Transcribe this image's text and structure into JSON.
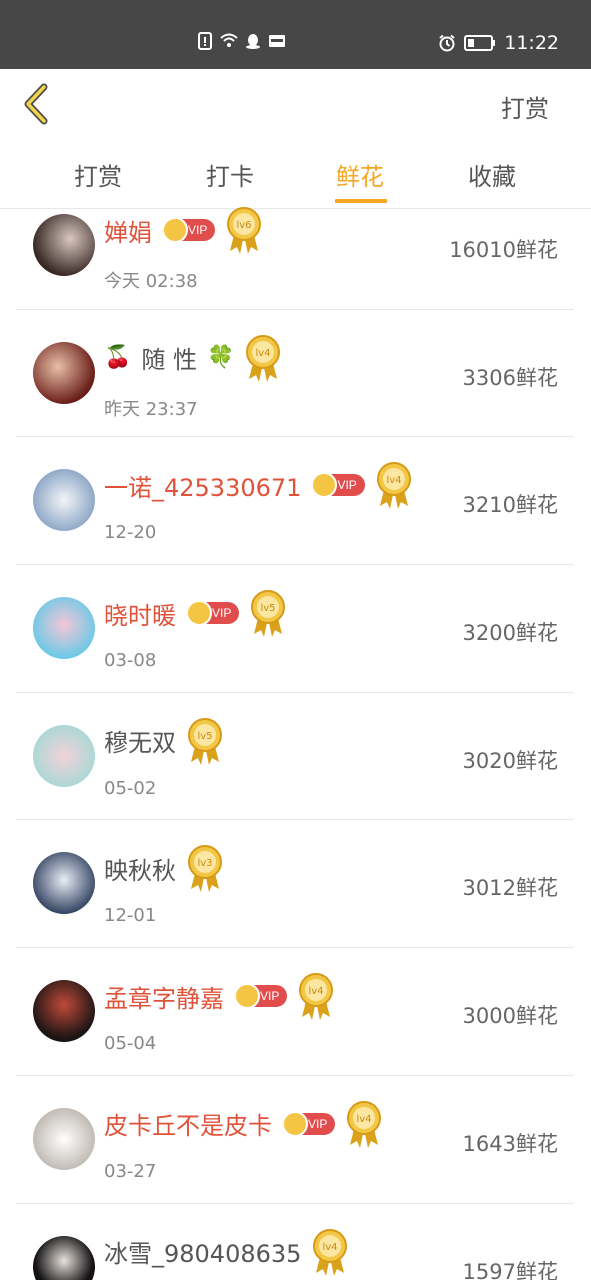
{
  "status_bar": {
    "time": "11:22"
  },
  "header": {
    "right_label": "打赏"
  },
  "tabs": [
    {
      "label": "打赏",
      "active": false
    },
    {
      "label": "打卡",
      "active": false
    },
    {
      "label": "鲜花",
      "active": true
    },
    {
      "label": "收藏",
      "active": false
    }
  ],
  "colors": {
    "accent": "#f5a623",
    "vip_name": "#e0533a",
    "vip_badge": "#e14c4c"
  },
  "rows": [
    {
      "name": "婵娟",
      "vip": true,
      "vip_text": "VIP",
      "level": "lv6",
      "time": "今天 02:38",
      "count": "16010鲜花"
    },
    {
      "name": "随 性",
      "prefix_emoji": "🍒",
      "suffix_emoji": "🍀",
      "vip": false,
      "level": "lv4",
      "time": "昨天 23:37",
      "count": "3306鲜花"
    },
    {
      "name": "一诺_425330671",
      "vip": true,
      "vip_text": "VIP",
      "level": "lv4",
      "time": "12-20",
      "count": "3210鲜花"
    },
    {
      "name": "晓时暖",
      "vip": true,
      "vip_text": "VIP",
      "level": "lv5",
      "time": "03-08",
      "count": "3200鲜花"
    },
    {
      "name": "穆无双",
      "vip": false,
      "level": "lv5",
      "time": "05-02",
      "count": "3020鲜花"
    },
    {
      "name": "映秋秋",
      "vip": false,
      "level": "lv3",
      "time": "12-01",
      "count": "3012鲜花"
    },
    {
      "name": "孟章字静嘉",
      "vip": true,
      "vip_text": "VIP",
      "level": "lv4",
      "time": "05-04",
      "count": "3000鲜花"
    },
    {
      "name": "皮卡丘不是皮卡",
      "vip": true,
      "vip_text": "VIP",
      "level": "lv4",
      "time": "03-27",
      "count": "1643鲜花"
    },
    {
      "name": "冰雪_980408635",
      "vip": false,
      "level": "lv4",
      "time": "",
      "count": "1597鲜花"
    }
  ]
}
